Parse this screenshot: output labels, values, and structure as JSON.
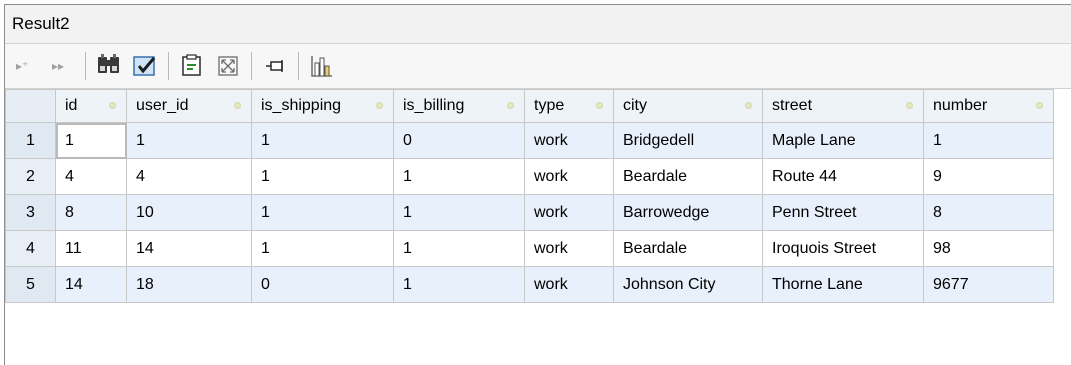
{
  "window": {
    "title": "Result2"
  },
  "toolbar": {
    "buttons": [
      {
        "icon": "insert-row-icon",
        "label": "▸⁺"
      },
      {
        "icon": "next-icon",
        "label": "▸▸"
      },
      {
        "icon": "find-icon"
      },
      {
        "icon": "clear-filter-icon"
      },
      {
        "icon": "export-icon"
      },
      {
        "icon": "maximize-icon"
      },
      {
        "icon": "pin-icon"
      },
      {
        "icon": "chart-icon"
      }
    ]
  },
  "table": {
    "columns": [
      "id",
      "user_id",
      "is_shipping",
      "is_billing",
      "type",
      "city",
      "street",
      "number"
    ],
    "rows": [
      {
        "n": "1",
        "cells": [
          "1",
          "1",
          "1",
          "0",
          "work",
          "Bridgedell",
          "Maple Lane",
          "1"
        ]
      },
      {
        "n": "2",
        "cells": [
          "4",
          "4",
          "1",
          "1",
          "work",
          "Beardale",
          "Route 44",
          "9"
        ]
      },
      {
        "n": "3",
        "cells": [
          "8",
          "10",
          "1",
          "1",
          "work",
          "Barrowedge",
          "Penn Street",
          "8"
        ]
      },
      {
        "n": "4",
        "cells": [
          "11",
          "14",
          "1",
          "1",
          "work",
          "Beardale",
          "Iroquois Street",
          "98"
        ]
      },
      {
        "n": "5",
        "cells": [
          "14",
          "18",
          "0",
          "1",
          "work",
          "Johnson City",
          "Thorne Lane",
          "9677"
        ]
      }
    ]
  }
}
